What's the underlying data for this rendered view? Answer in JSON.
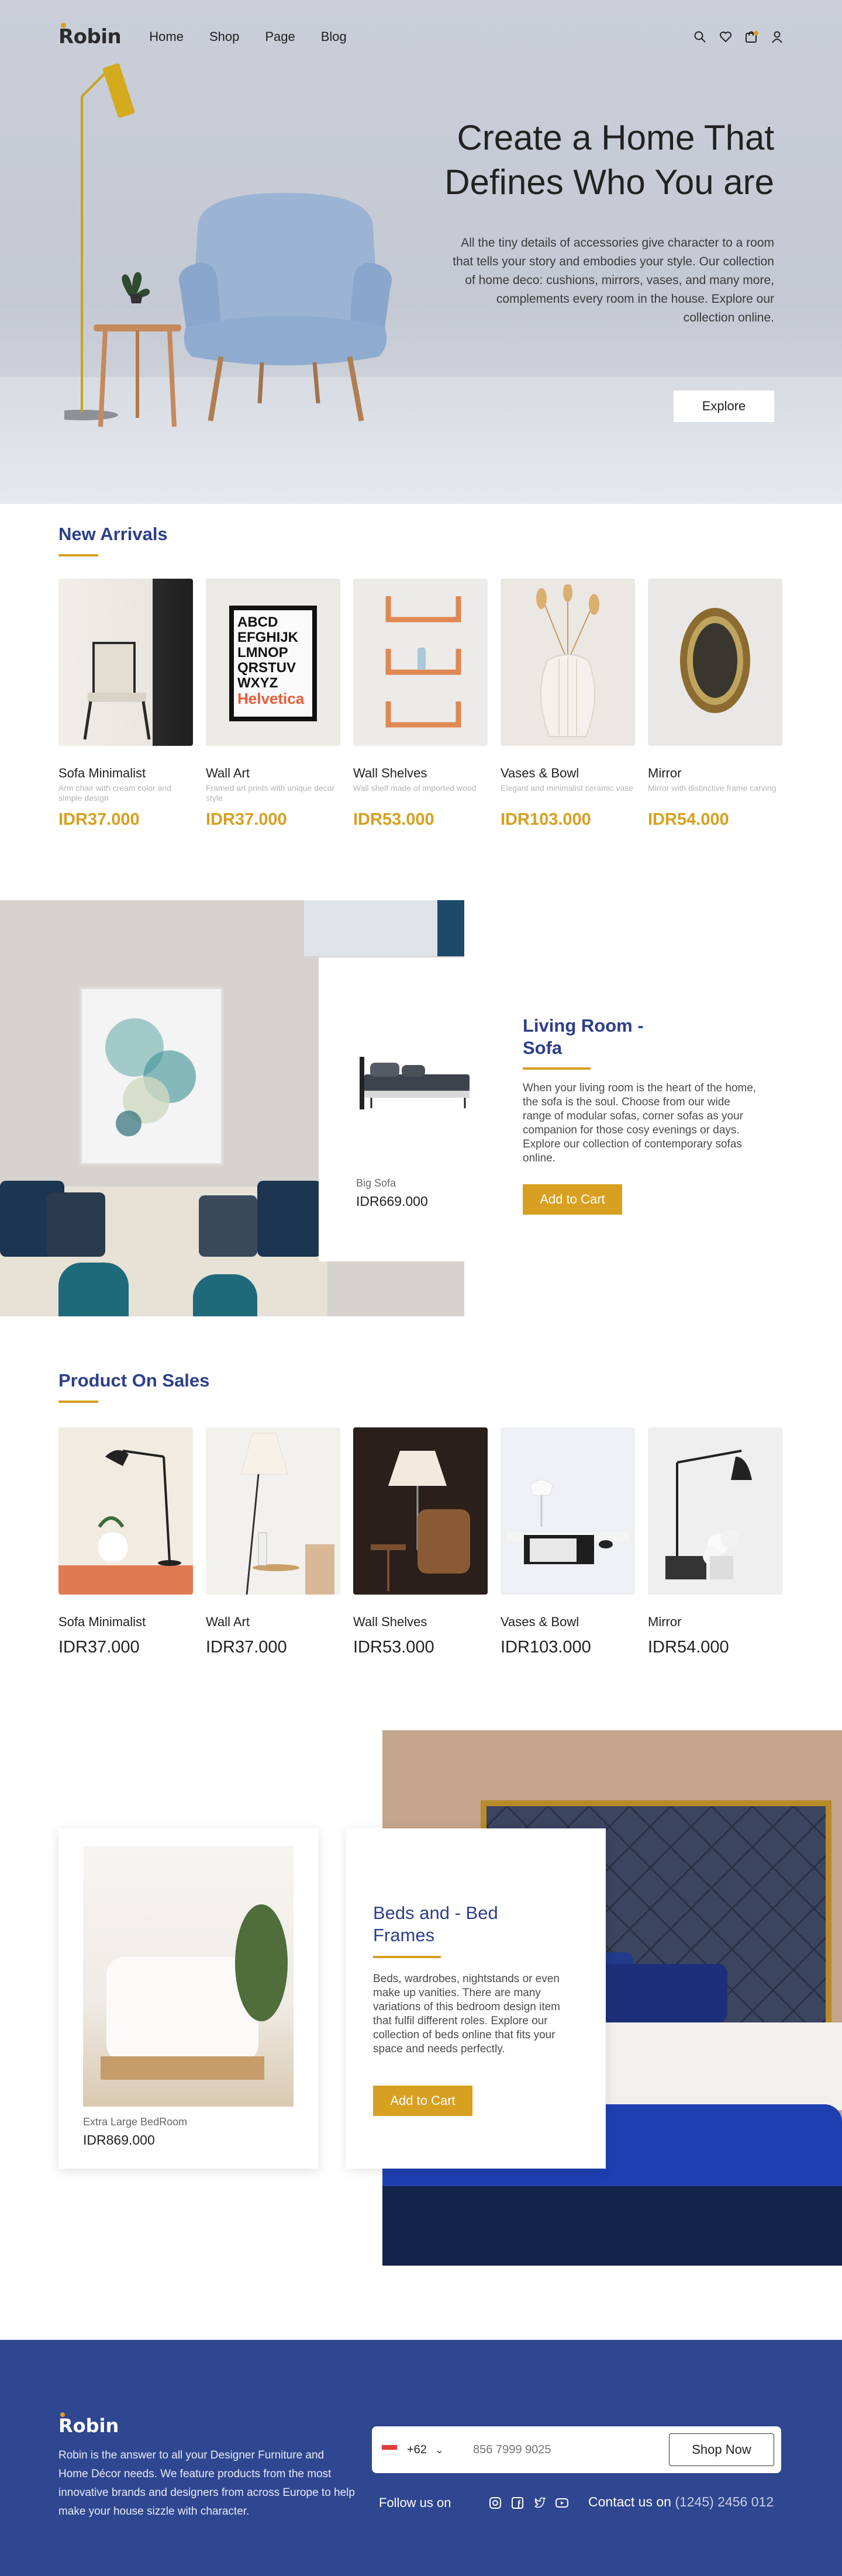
{
  "nav": {
    "logo": "Robin",
    "links": [
      "Home",
      "Shop",
      "Page",
      "Blog"
    ],
    "icons": [
      "search-icon",
      "heart-icon",
      "cart-icon",
      "user-icon"
    ]
  },
  "hero": {
    "title_line1": "Create a Home That",
    "title_line2": "Defines Who You are",
    "description": "All the tiny details of accessories give character to a room that tells your story and embodies your style. Our collection of home deco: cushions, mirrors, vases, and many more, complements every room in the house. Explore our collection online.",
    "button": "Explore"
  },
  "new_arrivals": {
    "title": "New Arrivals",
    "items": [
      {
        "name": "Sofa Minimalist",
        "desc": "Arm chair with cream color and simple design",
        "price": "IDR37.000"
      },
      {
        "name": "Wall Art",
        "desc": "Framed art prints with unique decor style",
        "price": "IDR37.000"
      },
      {
        "name": "Wall Shelves",
        "desc": "Wall shelf made of imported wood",
        "price": "IDR53.000"
      },
      {
        "name": "Vases & Bowl",
        "desc": "Elegant and minimalist ceramic vase",
        "price": "IDR103.000"
      },
      {
        "name": "Mirror",
        "desc": "Mirror with distinctive frame carving",
        "price": "IDR54.000"
      }
    ],
    "poster_text": [
      "ABCD",
      "EFGHIJK",
      "LMNOP",
      "QRSTUV",
      "WXYZ",
      "Helvetica"
    ]
  },
  "living_room": {
    "title": "Living Room - Sofa",
    "description": "When your living room is the heart of the home, the sofa is the soul. Choose from our wide range of modular sofas, corner sofas as your companion for those cosy evenings or days. Explore our collection of contemporary sofas online.",
    "button": "Add to Cart",
    "card_name": "Big Sofa",
    "card_price": "IDR669.000"
  },
  "on_sales": {
    "title": "Product On Sales",
    "items": [
      {
        "name": "Sofa Minimalist",
        "price": "IDR37.000"
      },
      {
        "name": "Wall Art",
        "price": "IDR37.000"
      },
      {
        "name": "Wall Shelves",
        "price": "IDR53.000"
      },
      {
        "name": "Vases & Bowl",
        "price": "IDR103.000"
      },
      {
        "name": "Mirror",
        "price": "IDR54.000"
      }
    ]
  },
  "beds": {
    "title": "Beds and - Bed Frames",
    "description": "Beds, wardrobes, nightstands or even make up vanities. There are many variations of this bedroom design item that fulfil different roles. Explore our collection of beds online that fits your space and needs perfectly.",
    "button": "Add to Cart",
    "card_name": "Extra Large BedRoom",
    "card_price": "IDR869.000"
  },
  "footer": {
    "logo": "Robin",
    "about": "Robin is the answer to all your Designer Furniture and Home Décor needs. We feature products from the most innovative brands and designers from across Europe to help make your house sizzle with character.",
    "country_code": "+62",
    "phone_placeholder": "856 7999 9025",
    "shop_button": "Shop Now",
    "follow_label": "Follow us on",
    "social_icons": [
      "instagram-icon",
      "facebook-icon",
      "twitter-icon",
      "youtube-icon"
    ],
    "contact_label": "Contact us on",
    "contact_number": "(1245) 2456 012"
  },
  "colors": {
    "accent": "#d7a020",
    "brand_blue": "#2d3f8a",
    "footer_bg": "#2f4690"
  }
}
